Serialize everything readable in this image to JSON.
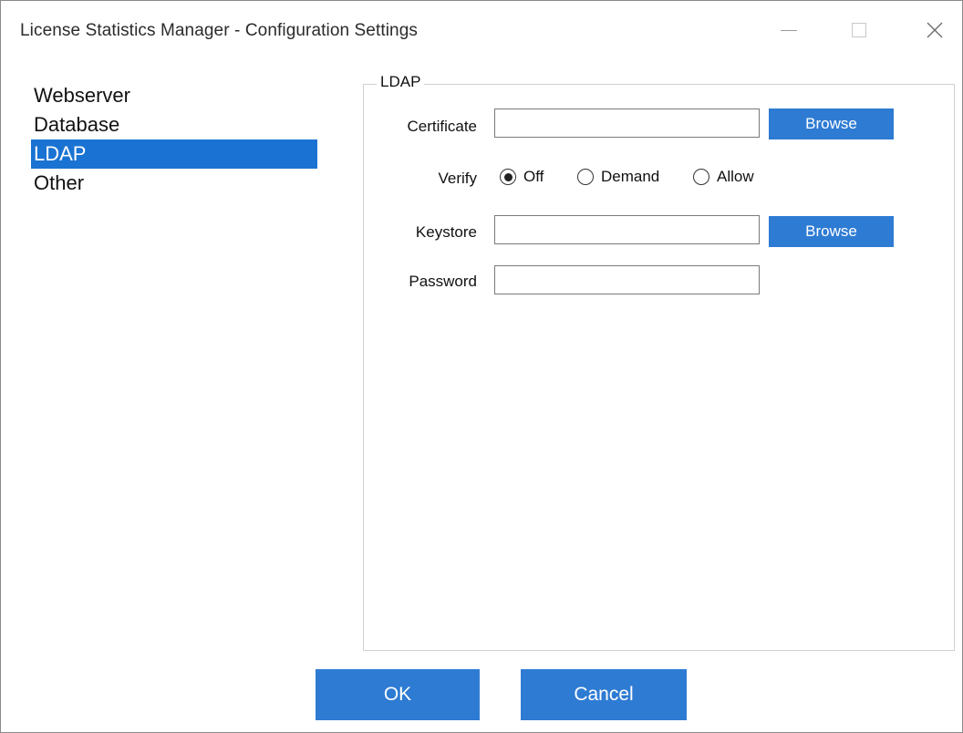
{
  "window": {
    "title": "License Statistics Manager - Configuration Settings"
  },
  "nav": {
    "items": [
      {
        "label": "Webserver",
        "selected": false
      },
      {
        "label": "Database",
        "selected": false
      },
      {
        "label": "LDAP",
        "selected": true
      },
      {
        "label": "Other",
        "selected": false
      }
    ]
  },
  "ldap": {
    "legend": "LDAP",
    "certificate_label": "Certificate",
    "certificate_value": "",
    "browse_label": "Browse",
    "verify_label": "Verify",
    "verify_options": [
      {
        "label": "Off",
        "checked": true
      },
      {
        "label": "Demand",
        "checked": false
      },
      {
        "label": "Allow",
        "checked": false
      }
    ],
    "keystore_label": "Keystore",
    "keystore_value": "",
    "password_label": "Password",
    "password_value": ""
  },
  "footer": {
    "ok_label": "OK",
    "cancel_label": "Cancel"
  },
  "colors": {
    "accent": "#2e7bd3",
    "selection": "#1a73d2"
  }
}
